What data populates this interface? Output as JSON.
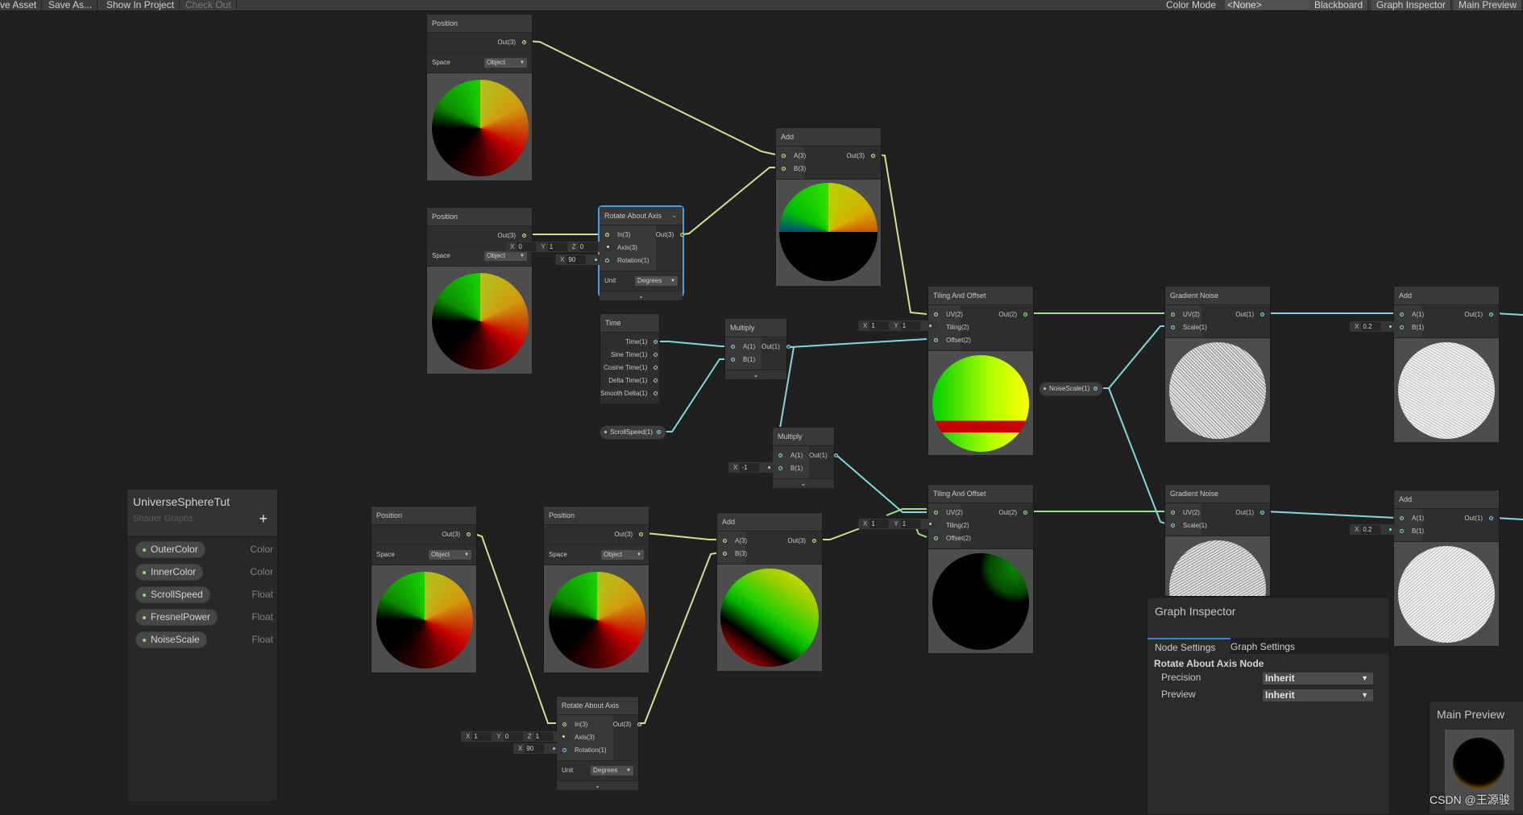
{
  "toolbar": {
    "buttons": [
      "ve Asset",
      "Save As...",
      "Show In Project",
      "Check Out"
    ],
    "color_mode_label": "Color Mode",
    "color_mode_value": "<None>",
    "toggles": [
      "Blackboard",
      "Graph Inspector",
      "Main Preview"
    ]
  },
  "nodes": {
    "position1": {
      "title": "Position",
      "out": "Out(3)",
      "space_label": "Space",
      "space_value": "Object"
    },
    "position2": {
      "title": "Position",
      "out": "Out(3)",
      "space_label": "Space",
      "space_value": "Object"
    },
    "position3": {
      "title": "Position",
      "out": "Out(3)",
      "space_label": "Space",
      "space_value": "Object"
    },
    "position4": {
      "title": "Position",
      "out": "Out(3)",
      "space_label": "Space",
      "space_value": "Object"
    },
    "rotate1": {
      "title": "Rotate About Axis",
      "inputs": [
        "In(3)",
        "Axis(3)",
        "Rotation(1)"
      ],
      "out": "Out(3)",
      "unit_label": "Unit",
      "unit_value": "Degrees",
      "axis": {
        "x": "0",
        "y": "1",
        "z": "0"
      },
      "rotation": "90"
    },
    "rotate2": {
      "title": "Rotate About Axis",
      "inputs": [
        "In(3)",
        "Axis(3)",
        "Rotation(1)"
      ],
      "out": "Out(3)",
      "unit_label": "Unit",
      "unit_value": "Degrees",
      "axis": {
        "x": "1",
        "y": "0",
        "z": "1"
      },
      "rotation": "90"
    },
    "add1": {
      "title": "Add",
      "inputs": [
        "A(3)",
        "B(3)"
      ],
      "out": "Out(3)"
    },
    "add2": {
      "title": "Add",
      "inputs": [
        "A(3)",
        "B(3)"
      ],
      "out": "Out(3)"
    },
    "add3": {
      "title": "Add",
      "inputs": [
        "A(1)",
        "B(1)"
      ],
      "out": "Out(1)",
      "b_value": "0.2"
    },
    "add4": {
      "title": "Add",
      "inputs": [
        "A(1)",
        "B(1)"
      ],
      "out": "Out(1)",
      "b_value": "0.2"
    },
    "time": {
      "title": "Time",
      "outputs": [
        "Time(1)",
        "Sine Time(1)",
        "Cosine Time(1)",
        "Delta Time(1)",
        "Smooth Delta(1)"
      ]
    },
    "multiply1": {
      "title": "Multiply",
      "inputs": [
        "A(1)",
        "B(1)"
      ],
      "out": "Out(1)"
    },
    "multiply2": {
      "title": "Multiply",
      "inputs": [
        "A(1)",
        "B(1)"
      ],
      "out": "Out(1)",
      "b_value": "-1"
    },
    "tiling1": {
      "title": "Tiling And Offset",
      "inputs": [
        "UV(2)",
        "Tiling(2)",
        "Offset(2)"
      ],
      "out": "Out(2)",
      "tiling": {
        "x": "1",
        "y": "1"
      }
    },
    "tiling2": {
      "title": "Tiling And Offset",
      "inputs": [
        "UV(2)",
        "Tiling(2)",
        "Offset(2)"
      ],
      "out": "Out(2)",
      "tiling": {
        "x": "1",
        "y": "1"
      }
    },
    "noise1": {
      "title": "Gradient Noise",
      "inputs": [
        "UV(2)",
        "Scale(1)"
      ],
      "out": "Out(1)"
    },
    "noise2": {
      "title": "Gradient Noise",
      "inputs": [
        "UV(2)",
        "Scale(1)"
      ],
      "out": "Out(1)"
    }
  },
  "property_nodes": {
    "scroll_speed": "ScrollSpeed(1)",
    "noise_scale": "NoiseScale(1)"
  },
  "blackboard": {
    "title": "UniverseSphereTut",
    "subtitle": "Shader Graphs",
    "add_icon": "+",
    "properties": [
      {
        "name": "OuterColor",
        "type": "Color"
      },
      {
        "name": "InnerColor",
        "type": "Color"
      },
      {
        "name": "ScrollSpeed",
        "type": "Float"
      },
      {
        "name": "FresnelPower",
        "type": "Float"
      },
      {
        "name": "NoiseScale",
        "type": "Float"
      }
    ]
  },
  "inspector": {
    "title": "Graph Inspector",
    "tabs": [
      "Node Settings",
      "Graph Settings"
    ],
    "active_tab": "Node Settings",
    "section": "Rotate About Axis Node",
    "fields": [
      {
        "label": "Precision",
        "value": "Inherit"
      },
      {
        "label": "Preview",
        "value": "Inherit"
      }
    ]
  },
  "main_preview": {
    "title": "Main Preview"
  },
  "watermark": "CSDN @王源骏",
  "colors": {
    "vec3_wire": "#d8de8a",
    "float_wire": "#80d8df",
    "vec2_wire": "#9be08c",
    "selection": "#4a9fdf",
    "tab_accent": "#3f7fd1"
  }
}
